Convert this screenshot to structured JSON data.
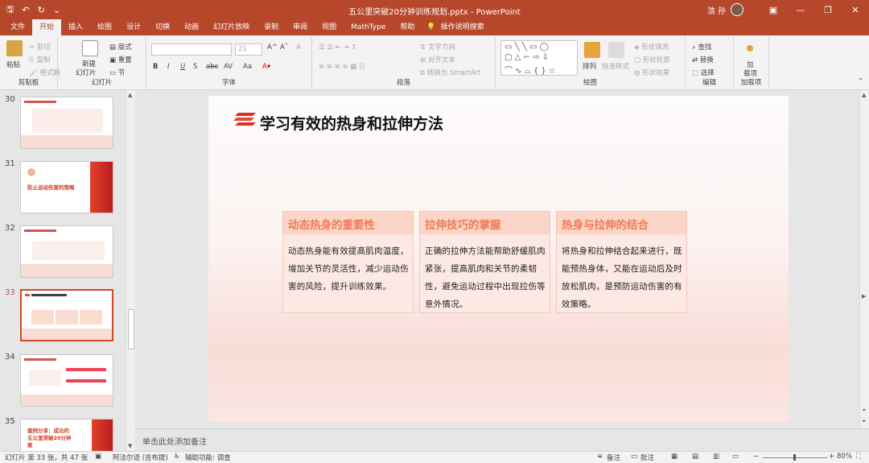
{
  "titlebar": {
    "doc_title": "五公里突破20分钟训练规划.pptx  -  PowerPoint",
    "user": "浩 孙",
    "minimize": "—",
    "restore": "❐",
    "close": "✕",
    "ribbon_display": "▣"
  },
  "tabs": [
    "文件",
    "开始",
    "插入",
    "绘图",
    "设计",
    "切换",
    "动画",
    "幻灯片放映",
    "录制",
    "审阅",
    "视图",
    "MathType",
    "帮助"
  ],
  "active_tab": "开始",
  "tell_me": "操作说明搜索",
  "ribbon": {
    "clipboard": {
      "label": "剪贴板",
      "paste": "粘贴",
      "cut": "剪切",
      "copy": "复制",
      "format_painter": "格式刷"
    },
    "slides": {
      "label": "幻灯片",
      "new_slide": "新建",
      "new_slide2": "幻灯片",
      "layout": "版式",
      "reset": "重置",
      "section": "节"
    },
    "font": {
      "label": "字体",
      "font_size": "21",
      "bold": "B",
      "italic": "I",
      "underline": "U",
      "shadow": "S",
      "strike": "abc",
      "spacing": "AV",
      "case": "Aa",
      "clear": "A"
    },
    "paragraph": {
      "label": "段落",
      "text_direction": "文字方向",
      "align_text": "对齐文本",
      "smartart": "转换为 SmartArt"
    },
    "drawing": {
      "label": "绘图",
      "arrange": "排列",
      "quick_styles": "快速样式",
      "fill": "形状填充",
      "outline": "形状轮廓",
      "effects": "形状效果"
    },
    "editing": {
      "label": "编辑",
      "find": "查找",
      "replace": "替换",
      "select": "选择"
    },
    "addins": {
      "label": "加载项",
      "addin": "加",
      "addin2": "载项"
    }
  },
  "thumbnails": [
    {
      "num": "30",
      "title": ""
    },
    {
      "num": "31",
      "title": "防止运动伤害的策略"
    },
    {
      "num": "32",
      "title": ""
    },
    {
      "num": "33",
      "title": "学习有效的热身和拉伸方法"
    },
    {
      "num": "34",
      "title": ""
    },
    {
      "num": "35",
      "title": "案例分享：成功的五公里突破20分钟案"
    }
  ],
  "slide": {
    "title": "学习有效的热身和拉伸方法",
    "cards": [
      {
        "title": "动态热身的重要性",
        "body": "动态热身能有效提高肌肉温度，增加关节的灵活性，减少运动伤害的风险，提升训练效果。"
      },
      {
        "title": "拉伸技巧的掌握",
        "body": "正确的拉伸方法能帮助舒缓肌肉紧张，提高肌肉和关节的柔韧性，避免运动过程中出现拉伤等意外情况。"
      },
      {
        "title": "热身与拉伸的结合",
        "body": "将热身和拉伸结合起来进行，既能预热身体，又能在运动后及时放松肌肉，是预防运动伤害的有效策略。"
      }
    ]
  },
  "notes_placeholder": "单击此处添加备注",
  "status": {
    "slide_info": "幻灯片 第 33 张，共 47 张",
    "language": "阿法尔语 (吉布提)",
    "accessibility": "辅助功能: 调查",
    "notes": "备注",
    "comments": "批注",
    "zoom": "80%"
  },
  "colors": {
    "accent": "#b7472a",
    "card_title": "#ef7b55",
    "card_head": "#fbd5c7"
  }
}
